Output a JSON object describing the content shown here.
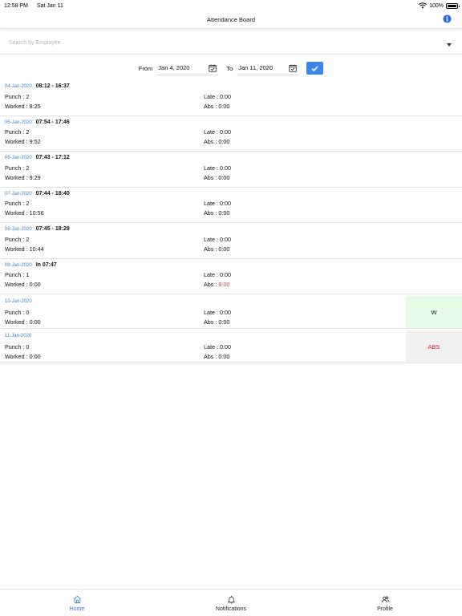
{
  "status_bar": {
    "time": "12:58 PM",
    "date": "Sat Jan 11",
    "battery": "100%"
  },
  "header": {
    "title": "Attendance Board"
  },
  "search": {
    "placeholder": "Search by Employee"
  },
  "date_filter": {
    "from_label": "From",
    "from_value": "Jan 4, 2020",
    "to_label": "To",
    "to_value": "Jan 11, 2020"
  },
  "records": [
    {
      "date": "04-Jan-2020",
      "time": "08:12 - 16:37",
      "punch": "Punch : 2",
      "worked": "Worked : 8:25",
      "late": "Late : 0:00",
      "abs_label": "Abs : ",
      "abs_value": "0:00"
    },
    {
      "date": "05-Jan-2020",
      "time": "07:54 - 17:46",
      "punch": "Punch : 2",
      "worked": "Worked : 9:52",
      "late": "Late : 0:00",
      "abs_label": "Abs : ",
      "abs_value": "0:00"
    },
    {
      "date": "06-Jan-2020",
      "time": "07:43 - 17:12",
      "punch": "Punch : 2",
      "worked": "Worked : 9:29",
      "late": "Late : 0:00",
      "abs_label": "Abs : ",
      "abs_value": "0:00"
    },
    {
      "date": "07-Jan-2020",
      "time": "07:44 - 18:40",
      "punch": "Punch : 2",
      "worked": "Worked : 10:56",
      "late": "Late : 0:00",
      "abs_label": "Abs : ",
      "abs_value": "0:00"
    },
    {
      "date": "08-Jan-2020",
      "time": "07:45 - 18:29",
      "punch": "Punch : 2",
      "worked": "Worked : 10:44",
      "late": "Late : 0:00",
      "abs_label": "Abs : ",
      "abs_value": "0:00"
    },
    {
      "date": "09-Jan-2020",
      "time": "In 07:47",
      "punch": "Punch : 1",
      "worked": "Worked : 0:00",
      "late": "Late : 0:00",
      "abs_label": "Abs : ",
      "abs_value": "8:00"
    },
    {
      "date": "10-Jan-2020",
      "time": "",
      "punch": "Punch : 0",
      "worked": "Worked : 0:00",
      "late": "Late : 0:00",
      "abs_label": "Abs : ",
      "abs_value": "0:00",
      "status": "W"
    },
    {
      "date": "11-Jan-2020",
      "time": "",
      "punch": "Punch : 0",
      "worked": "Worked : 0:00",
      "late": "Late : 0:00",
      "abs_label": "Abs : ",
      "abs_value": "0:00",
      "status": "ABS"
    }
  ],
  "tabs": [
    {
      "label": "Home",
      "icon": "home-icon"
    },
    {
      "label": "Notifications",
      "icon": "bell-icon"
    },
    {
      "label": "Profile",
      "icon": "users-icon"
    }
  ],
  "colors": {
    "accent": "#3b86e6",
    "date_text": "#3a84c9",
    "absent_red": "#e23b3b",
    "weekend_bg": "#e7f9e7",
    "absent_bg": "#f1f1f1"
  }
}
